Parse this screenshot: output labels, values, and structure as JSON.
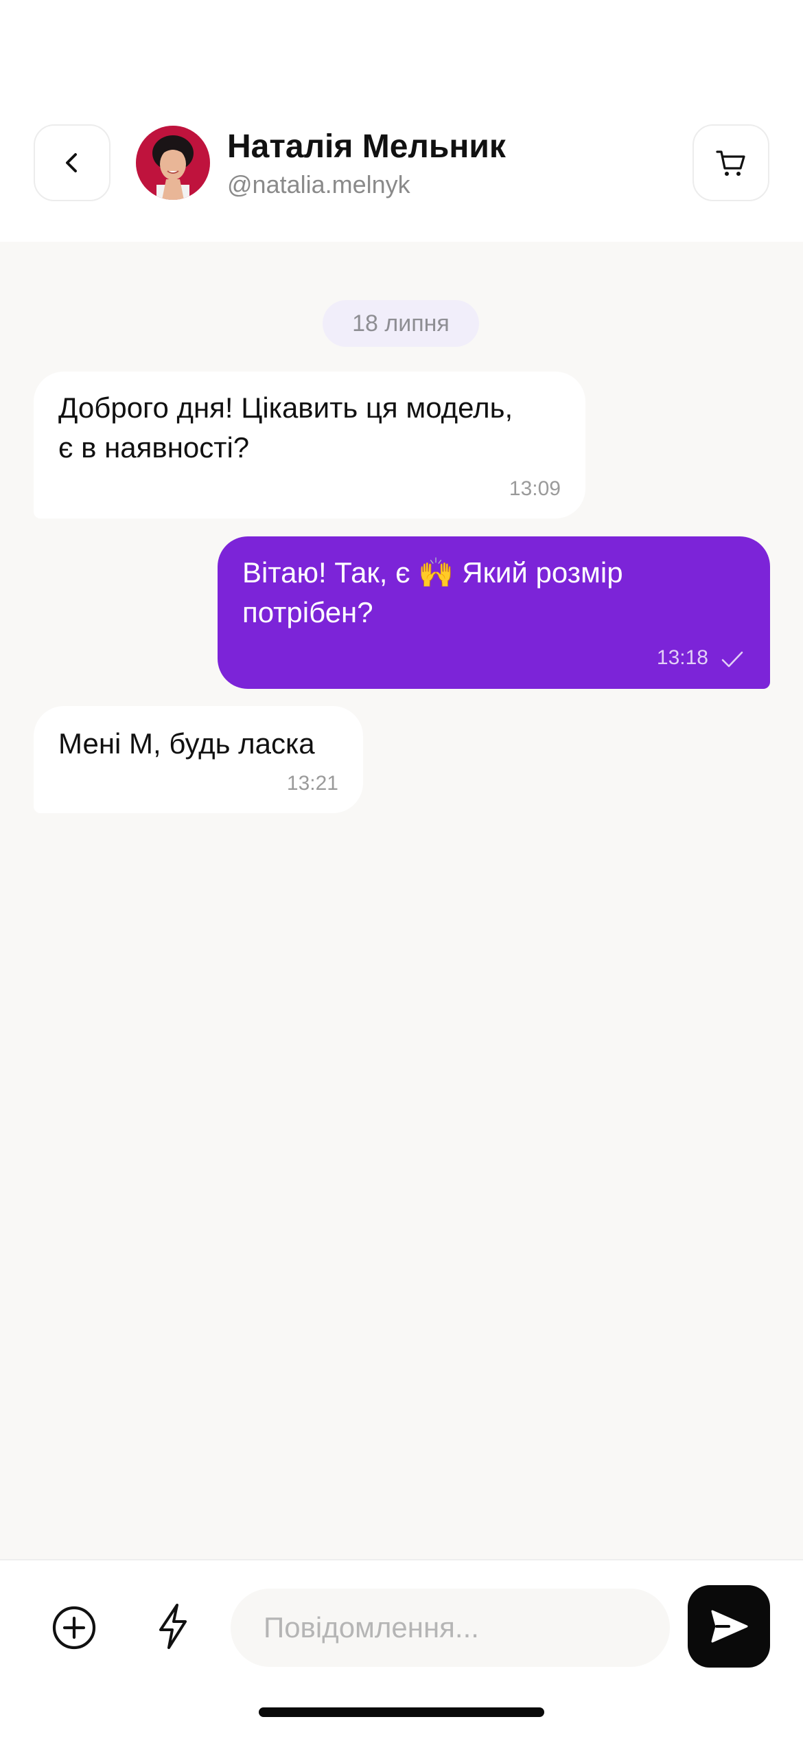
{
  "header": {
    "contact_name": "Наталія Мельник",
    "contact_handle": "@natalia.melnyk",
    "back_icon": "chevron-left-icon",
    "cart_icon": "shopping-cart-icon"
  },
  "chat": {
    "date_separator": "18 липня",
    "messages": [
      {
        "direction": "incoming",
        "lines": [
          "Доброго дня! Цікавить ця модель,",
          "є в наявності?"
        ],
        "time": "13:09"
      },
      {
        "direction": "outgoing",
        "lines": [
          "Вітаю! Так, є 🙌 Який розмір",
          "потрібен?"
        ],
        "time": "13:18",
        "status_icon": "checkmark-icon"
      },
      {
        "direction": "incoming",
        "lines": [
          "Мені M, будь ласка"
        ],
        "time": "13:21"
      }
    ]
  },
  "composer": {
    "placeholder": "Повідомлення...",
    "value": "",
    "add_icon": "plus-circle-icon",
    "quick_reply_icon": "lightning-icon",
    "send_icon": "send-icon"
  },
  "colors": {
    "accent": "#7c24d8",
    "chat_background": "#f9f8f6",
    "date_pill_background": "#f1eefa",
    "send_button": "#0a0a0a"
  }
}
